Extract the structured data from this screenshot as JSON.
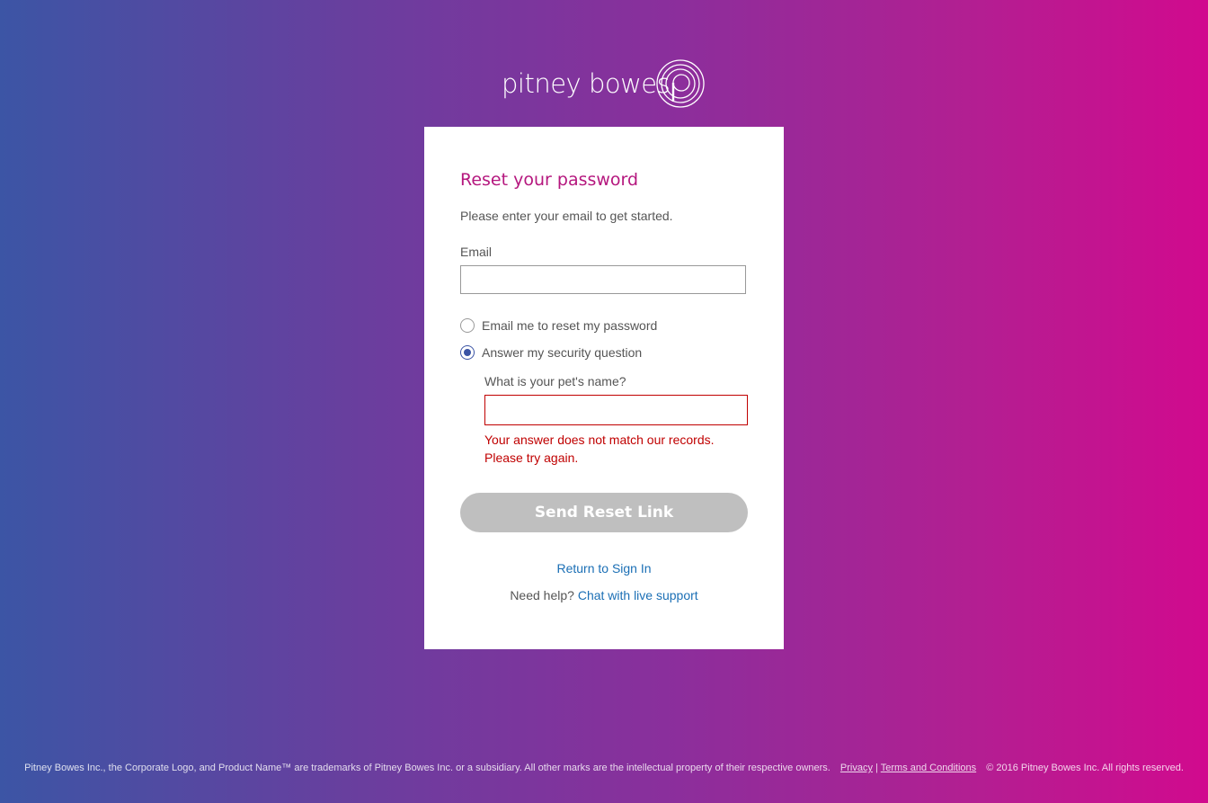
{
  "brand": {
    "logo_text": "pitney bowes",
    "logo_icon": "pitney-bowes-concentric-p-icon"
  },
  "form": {
    "title": "Reset your password",
    "intro": "Please enter your email to get started.",
    "email_label": "Email",
    "email_value": "",
    "options": [
      {
        "label": "Email me to reset my password",
        "checked": false
      },
      {
        "label": "Answer my security question",
        "checked": true
      }
    ],
    "security_question": "What is your pet's name?",
    "answer_value": "",
    "error_message": "Your answer does not match our records. Please try again.",
    "submit_label": "Send Reset Link",
    "return_link": "Return to Sign In",
    "help_prefix": "Need help?",
    "help_link": "Chat with live support"
  },
  "footer": {
    "trademark_text": "Pitney Bowes Inc., the Corporate Logo, and Product Name™ are trademarks of Pitney Bowes Inc. or a subsidiary. All other marks are the intellectual property of their respective owners.",
    "privacy_link": "Privacy",
    "separator": "|",
    "terms_link": "Terms and Conditions",
    "copyright": "© 2016 Pitney Bowes Inc. All rights reserved."
  },
  "colors": {
    "accent_title": "#b5177e",
    "link": "#1b6fb5",
    "error": "#c00000",
    "radio_selected": "#3a53a4",
    "button_disabled": "#bfbfbf"
  }
}
